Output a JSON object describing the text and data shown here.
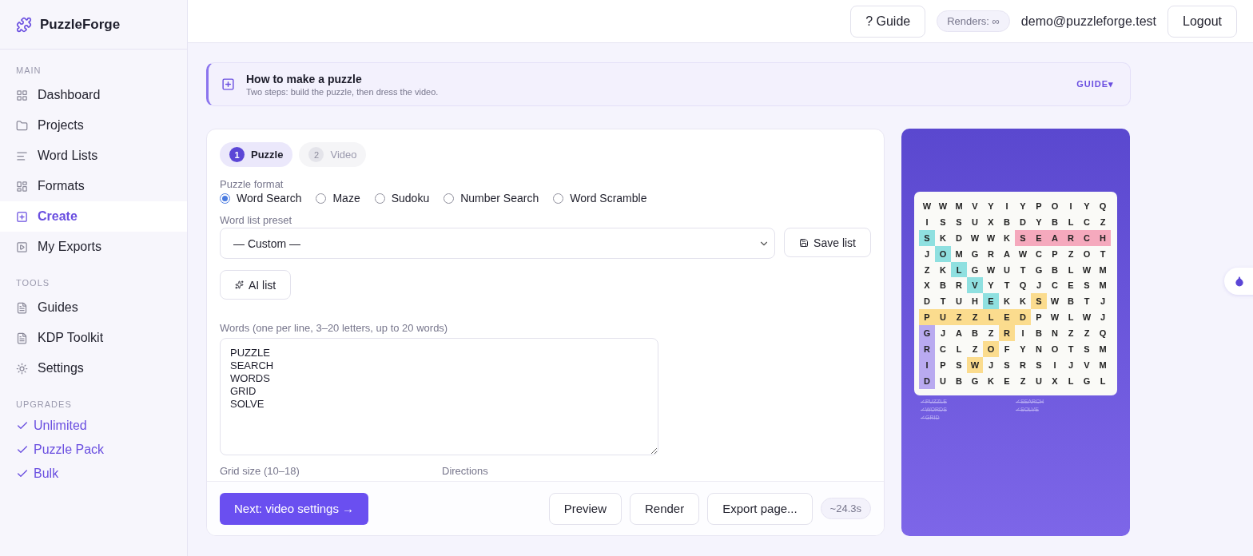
{
  "brand": {
    "name": "PuzzleForge"
  },
  "sidebar": {
    "sections": [
      {
        "title": "MAIN",
        "items": [
          {
            "label": "Dashboard",
            "selected": false
          },
          {
            "label": "Projects",
            "selected": false
          },
          {
            "label": "Word Lists",
            "selected": false
          },
          {
            "label": "Formats",
            "selected": false
          },
          {
            "label": "Create",
            "selected": true
          },
          {
            "label": "My Exports",
            "selected": false
          }
        ]
      },
      {
        "title": "TOOLS",
        "items": [
          {
            "label": "Guides",
            "selected": false
          },
          {
            "label": "KDP Toolkit",
            "selected": false
          },
          {
            "label": "Settings",
            "selected": false
          }
        ]
      }
    ],
    "upgrades": {
      "title": "UPGRADES",
      "items": [
        "Unlimited",
        "Puzzle Pack",
        "Bulk"
      ]
    }
  },
  "topbar": {
    "guide_button": "? Guide",
    "renders_badge": "Renders: ∞",
    "user_email": "demo@puzzleforge.test",
    "logout_button": "Logout"
  },
  "banner": {
    "title": "How to make a puzzle",
    "subtitle": "Two steps: build the puzzle, then dress the video.",
    "link": "GUIDE▾"
  },
  "steps": [
    {
      "number": "1",
      "label": "Puzzle",
      "selected": true
    },
    {
      "number": "2",
      "label": "Video",
      "selected": false
    }
  ],
  "form": {
    "format_label": "Puzzle format",
    "formats": [
      {
        "label": "Word Search",
        "selected": true
      },
      {
        "label": "Maze",
        "selected": false
      },
      {
        "label": "Sudoku",
        "selected": false
      },
      {
        "label": "Number Search",
        "selected": false
      },
      {
        "label": "Word Scramble",
        "selected": false
      }
    ],
    "preset_label": "Word list preset",
    "preset_value": "— Custom —",
    "save_button": "Save list",
    "ai_button": "AI list",
    "words_label": "Words (one per line, 3–20 letters, up to 20 words)",
    "words_value": "PUZZLE\nSEARCH\nWORDS\nGRID\nSOLVE",
    "grid_size_label": "Grid size (10–18)",
    "directions_label": "Directions"
  },
  "footer": {
    "next_button": "Next: video settings →",
    "preview_button": "Preview",
    "render_button": "Render",
    "export_button": "Export page...",
    "estimate": "~24.3s"
  },
  "preview": {
    "grid": [
      [
        {
          "letter": "W"
        },
        {
          "letter": "W"
        },
        {
          "letter": "M"
        },
        {
          "letter": "V"
        },
        {
          "letter": "Y"
        },
        {
          "letter": "I"
        },
        {
          "letter": "Y"
        },
        {
          "letter": "P"
        },
        {
          "letter": "O"
        },
        {
          "letter": "I"
        },
        {
          "letter": "Y"
        },
        {
          "letter": "Q"
        }
      ],
      [
        {
          "letter": "I"
        },
        {
          "letter": "S"
        },
        {
          "letter": "S"
        },
        {
          "letter": "U"
        },
        {
          "letter": "X"
        },
        {
          "letter": "B"
        },
        {
          "letter": "D"
        },
        {
          "letter": "Y"
        },
        {
          "letter": "B"
        },
        {
          "letter": "L"
        },
        {
          "letter": "C"
        },
        {
          "letter": "Z"
        }
      ],
      [
        {
          "letter": "S",
          "color": "#8fe0e0"
        },
        {
          "letter": "K"
        },
        {
          "letter": "D"
        },
        {
          "letter": "W"
        },
        {
          "letter": "W"
        },
        {
          "letter": "K"
        },
        {
          "letter": "S",
          "color": "#f5a9bd"
        },
        {
          "letter": "E",
          "color": "#f5a9bd"
        },
        {
          "letter": "A",
          "color": "#f5a9bd"
        },
        {
          "letter": "R",
          "color": "#f5a9bd"
        },
        {
          "letter": "C",
          "color": "#f5a9bd"
        },
        {
          "letter": "H",
          "color": "#f5a9bd"
        }
      ],
      [
        {
          "letter": "J"
        },
        {
          "letter": "O",
          "color": "#8fe0e0"
        },
        {
          "letter": "M"
        },
        {
          "letter": "G"
        },
        {
          "letter": "R"
        },
        {
          "letter": "A"
        },
        {
          "letter": "W"
        },
        {
          "letter": "C"
        },
        {
          "letter": "P"
        },
        {
          "letter": "Z"
        },
        {
          "letter": "O"
        },
        {
          "letter": "T"
        }
      ],
      [
        {
          "letter": "Z"
        },
        {
          "letter": "K"
        },
        {
          "letter": "L",
          "color": "#8fe0e0"
        },
        {
          "letter": "G"
        },
        {
          "letter": "W"
        },
        {
          "letter": "U"
        },
        {
          "letter": "T"
        },
        {
          "letter": "G"
        },
        {
          "letter": "B"
        },
        {
          "letter": "L"
        },
        {
          "letter": "W"
        },
        {
          "letter": "M"
        }
      ],
      [
        {
          "letter": "X"
        },
        {
          "letter": "B"
        },
        {
          "letter": "R"
        },
        {
          "letter": "V",
          "color": "#8fe0e0"
        },
        {
          "letter": "Y"
        },
        {
          "letter": "T"
        },
        {
          "letter": "Q"
        },
        {
          "letter": "J"
        },
        {
          "letter": "C"
        },
        {
          "letter": "E"
        },
        {
          "letter": "S"
        },
        {
          "letter": "M"
        }
      ],
      [
        {
          "letter": "D"
        },
        {
          "letter": "T"
        },
        {
          "letter": "U"
        },
        {
          "letter": "H"
        },
        {
          "letter": "E",
          "color": "#8fe0e0"
        },
        {
          "letter": "K"
        },
        {
          "letter": "K"
        },
        {
          "letter": "S",
          "color": "#fbdc8e"
        },
        {
          "letter": "W"
        },
        {
          "letter": "B"
        },
        {
          "letter": "T"
        },
        {
          "letter": "J"
        }
      ],
      [
        {
          "letter": "P",
          "color": "#fbdc8e"
        },
        {
          "letter": "U",
          "color": "#fbdc8e"
        },
        {
          "letter": "Z",
          "color": "#fbdc8e"
        },
        {
          "letter": "Z",
          "color": "#fbdc8e"
        },
        {
          "letter": "L",
          "color": "#fbdc8e"
        },
        {
          "letter": "E",
          "color": "#fbdc8e"
        },
        {
          "letter": "D",
          "color": "#fbdc8e"
        },
        {
          "letter": "P"
        },
        {
          "letter": "W"
        },
        {
          "letter": "L"
        },
        {
          "letter": "W"
        },
        {
          "letter": "J"
        }
      ],
      [
        {
          "letter": "G",
          "color": "#b9aaf0"
        },
        {
          "letter": "J"
        },
        {
          "letter": "A"
        },
        {
          "letter": "B"
        },
        {
          "letter": "Z"
        },
        {
          "letter": "R",
          "color": "#fbdc8e"
        },
        {
          "letter": "I"
        },
        {
          "letter": "B"
        },
        {
          "letter": "N"
        },
        {
          "letter": "Z"
        },
        {
          "letter": "Z"
        },
        {
          "letter": "Q"
        }
      ],
      [
        {
          "letter": "R",
          "color": "#b9aaf0"
        },
        {
          "letter": "C"
        },
        {
          "letter": "L"
        },
        {
          "letter": "Z"
        },
        {
          "letter": "O",
          "color": "#fbdc8e"
        },
        {
          "letter": "F"
        },
        {
          "letter": "Y"
        },
        {
          "letter": "N"
        },
        {
          "letter": "O"
        },
        {
          "letter": "T"
        },
        {
          "letter": "S"
        },
        {
          "letter": "M"
        }
      ],
      [
        {
          "letter": "I",
          "color": "#b9aaf0"
        },
        {
          "letter": "P"
        },
        {
          "letter": "S"
        },
        {
          "letter": "W",
          "color": "#fbdc8e"
        },
        {
          "letter": "J"
        },
        {
          "letter": "S"
        },
        {
          "letter": "R"
        },
        {
          "letter": "S"
        },
        {
          "letter": "I"
        },
        {
          "letter": "J"
        },
        {
          "letter": "V"
        },
        {
          "letter": "M"
        }
      ],
      [
        {
          "letter": "D",
          "color": "#b9aaf0"
        },
        {
          "letter": "U"
        },
        {
          "letter": "B"
        },
        {
          "letter": "G"
        },
        {
          "letter": "K"
        },
        {
          "letter": "E"
        },
        {
          "letter": "Z"
        },
        {
          "letter": "U"
        },
        {
          "letter": "X"
        },
        {
          "letter": "L"
        },
        {
          "letter": "G"
        },
        {
          "letter": "L"
        }
      ]
    ],
    "found_words": [
      "✓PUZZLE",
      "✓SEARCH",
      "✓WORDS",
      "✓SOLVE",
      "✓GRID"
    ]
  }
}
